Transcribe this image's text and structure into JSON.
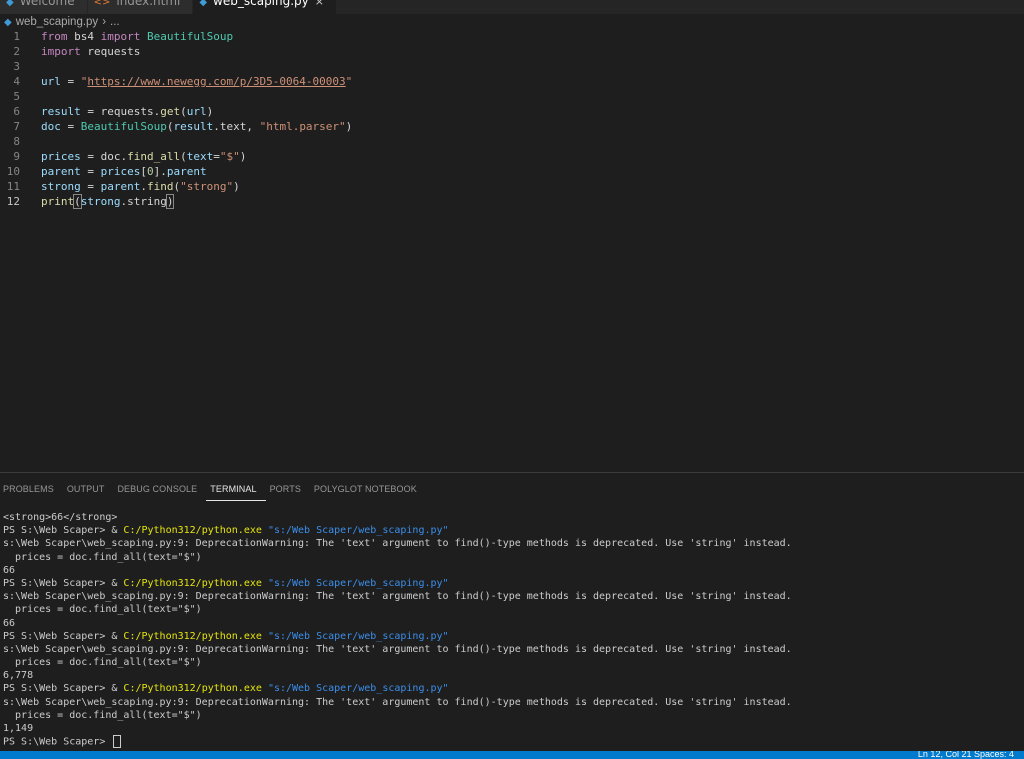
{
  "tabs": [
    {
      "label": "Welcome",
      "icon": "vscode-icon"
    },
    {
      "label": "index.html",
      "icon": "html-file-icon"
    },
    {
      "label": "web_scaping.py",
      "icon": "python-file-icon",
      "active": true,
      "close": "×"
    }
  ],
  "breadcrumb": {
    "file": "web_scaping.py",
    "separator": "›",
    "more": "..."
  },
  "editor": {
    "current_line": "12",
    "lines": [
      {
        "n": "1",
        "tokens": [
          [
            "kw",
            "from"
          ],
          [
            "op",
            " bs4 "
          ],
          [
            "kw",
            "import"
          ],
          [
            "op",
            " "
          ],
          [
            "mod",
            "BeautifulSoup"
          ]
        ]
      },
      {
        "n": "2",
        "tokens": [
          [
            "kw",
            "import"
          ],
          [
            "op",
            " requests"
          ]
        ]
      },
      {
        "n": "3",
        "tokens": []
      },
      {
        "n": "4",
        "tokens": [
          [
            "var",
            "url"
          ],
          [
            "op",
            " = "
          ],
          [
            "str",
            "\""
          ],
          [
            "strurl",
            "https://www.newegg.com/p/3D5-0064-00003"
          ],
          [
            "str",
            "\""
          ]
        ]
      },
      {
        "n": "5",
        "tokens": []
      },
      {
        "n": "6",
        "tokens": [
          [
            "var",
            "result"
          ],
          [
            "op",
            " = requests."
          ],
          [
            "fn",
            "get"
          ],
          [
            "op",
            "("
          ],
          [
            "var",
            "url"
          ],
          [
            "op",
            ")"
          ]
        ]
      },
      {
        "n": "7",
        "tokens": [
          [
            "var",
            "doc"
          ],
          [
            "op",
            " = "
          ],
          [
            "mod",
            "BeautifulSoup"
          ],
          [
            "op",
            "("
          ],
          [
            "var",
            "result"
          ],
          [
            "op",
            ".text, "
          ],
          [
            "str",
            "\"html.parser\""
          ],
          [
            "op",
            ")"
          ]
        ]
      },
      {
        "n": "8",
        "tokens": []
      },
      {
        "n": "9",
        "tokens": [
          [
            "var",
            "prices"
          ],
          [
            "op",
            " = doc."
          ],
          [
            "fn",
            "find_all"
          ],
          [
            "op",
            "("
          ],
          [
            "var",
            "text"
          ],
          [
            "op",
            "="
          ],
          [
            "str",
            "\"$\""
          ],
          [
            "op",
            ")"
          ]
        ]
      },
      {
        "n": "10",
        "tokens": [
          [
            "var",
            "parent"
          ],
          [
            "op",
            " = "
          ],
          [
            "var",
            "prices"
          ],
          [
            "op",
            "["
          ],
          [
            "num",
            "0"
          ],
          [
            "op",
            "]."
          ],
          [
            "var",
            "parent"
          ]
        ]
      },
      {
        "n": "11",
        "tokens": [
          [
            "var",
            "strong"
          ],
          [
            "op",
            " = "
          ],
          [
            "var",
            "parent"
          ],
          [
            "op",
            "."
          ],
          [
            "fn",
            "find"
          ],
          [
            "op",
            "("
          ],
          [
            "str",
            "\"strong\""
          ],
          [
            "op",
            ")"
          ]
        ]
      },
      {
        "n": "12",
        "tokens": [
          [
            "fn",
            "print"
          ],
          [
            "brk",
            "("
          ],
          [
            "var",
            "strong"
          ],
          [
            "op",
            ".string"
          ],
          [
            "brk",
            ")"
          ]
        ]
      }
    ]
  },
  "panel": {
    "tabs": [
      "PROBLEMS",
      "OUTPUT",
      "DEBUG CONSOLE",
      "TERMINAL",
      "PORTS",
      "POLYGLOT NOTEBOOK"
    ],
    "active_tab": "TERMINAL"
  },
  "terminal": {
    "prompt": "PS S:\\Web Scaper> ",
    "run_prefix": "& ",
    "exe": "C:/Python312/python.exe",
    "script": "\"s:/Web Scaper/web_scaping.py\"",
    "warning": "s:\\Web Scaper\\web_scaping.py:9: DeprecationWarning: The 'text' argument to find()-type methods is deprecated. Use 'string' instead.",
    "warning_code": "  prices = doc.find_all(text=\"$\")",
    "first_output": "<strong>66</strong>",
    "outputs": [
      "66",
      "66",
      "6,778",
      "1,149"
    ]
  },
  "statusbar": {
    "text": "Ln 12, Col 21   Spaces: 4"
  },
  "colors": {
    "accent": "#007acc",
    "editor_bg": "#1e1e1e",
    "exe_color": "#e5e510",
    "path_color": "#3b8eea"
  }
}
